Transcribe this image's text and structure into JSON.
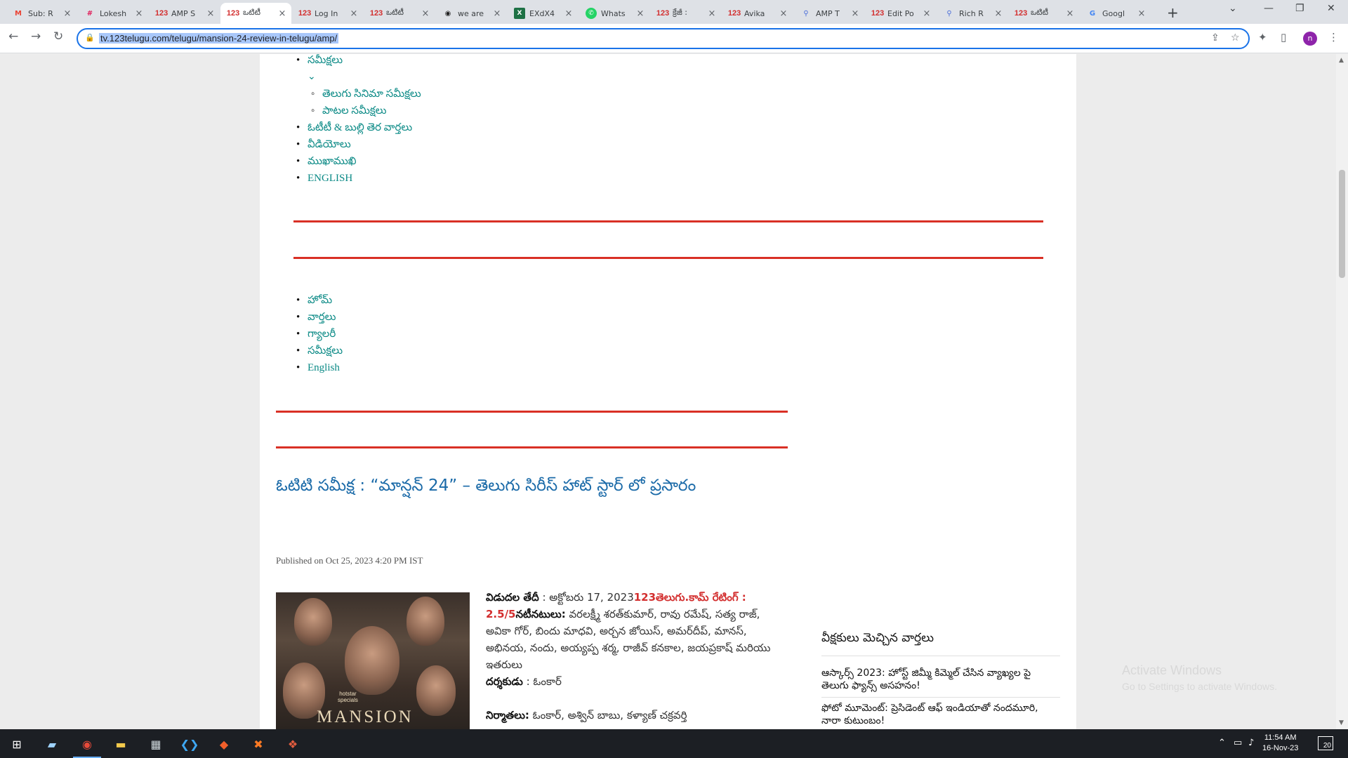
{
  "browser": {
    "tabs": [
      {
        "icon": "gmail-icon",
        "glyph": "M",
        "title": "Sub: R"
      },
      {
        "icon": "slack-icon",
        "glyph": "#",
        "title": "Lokesh"
      },
      {
        "icon": "site-123-icon",
        "glyph": "123",
        "title": "AMP S"
      },
      {
        "icon": "site-123-icon",
        "glyph": "123",
        "title": "ఒటిటీ"
      },
      {
        "icon": "site-123-icon",
        "glyph": "123",
        "title": "Log In"
      },
      {
        "icon": "site-123-icon",
        "glyph": "123",
        "title": "ఒటిటీ"
      },
      {
        "icon": "eye-icon",
        "glyph": "◉",
        "title": "we are"
      },
      {
        "icon": "excel-icon",
        "glyph": "X",
        "title": "EXdX4"
      },
      {
        "icon": "whatsapp-icon",
        "glyph": "✆",
        "title": "Whats"
      },
      {
        "icon": "site-123-icon",
        "glyph": "123",
        "title": "క్రేజీ :"
      },
      {
        "icon": "site-123-icon",
        "glyph": "123",
        "title": "Avika"
      },
      {
        "icon": "amp-icon",
        "glyph": "⚲",
        "title": "AMP T"
      },
      {
        "icon": "site-123-icon",
        "glyph": "123",
        "title": "Edit Po"
      },
      {
        "icon": "amp-icon",
        "glyph": "⚲",
        "title": "Rich R"
      },
      {
        "icon": "site-123-icon",
        "glyph": "123",
        "title": "ఒటిటీ"
      },
      {
        "icon": "google-docs-icon",
        "glyph": "G",
        "title": "Googl"
      }
    ],
    "url": "tv.123telugu.com/telugu/mansion-24-review-in-telugu/amp/",
    "profile_initial": "n"
  },
  "menu_top": {
    "items": [
      "సమీక్షలు",
      "తెలుగు సినిమా సమీక్షలు",
      "పాటల సమీక్షలు",
      "ఓటీటీ & బుల్లి తెర వార్తలు",
      "వీడియోలు",
      "ముఖాముఖి",
      "ENGLISH"
    ],
    "chevron": "⌄"
  },
  "menu_second": {
    "items": [
      "హోమ్",
      "వార్తలు",
      "గ్యాలరీ",
      "సమీక్షలు",
      "English"
    ]
  },
  "article": {
    "headline": "ఓటిటి సమీక్ష : “మాన్షన్ 24” – తెలుగు సిరీస్ హాట్ స్టార్ లో ప్రసారం",
    "published": "Published on Oct 25, 2023 4:20 PM IST",
    "poster": {
      "brand_line1": "hotstar",
      "brand_line2": "specials",
      "title": "MANSION"
    },
    "release_label": "విడుదల తేదీ",
    "release_value": " : అక్టోబరు 17, 2023",
    "rating_label": "123తెలుగు.కామ్ రేటింగ్ : 2.5/5",
    "cast_label": "నటీనటులు:",
    "cast_value": " వరలక్ష్మీ శరత్‌కుమార్, రావు రమేష్, సత్య రాజ్, అవికా గోర్, బిందు మాధవి, అర్చన జోయిస్, అమర్‌దీప్, మానస్, అభినయ, నందు, అయ్యప్ప శర్మ, రాజీవ్ కనకాల, జయప్రకాష్ మరియు ఇతరులు",
    "director_label": "దర్శకుడు",
    "director_value": " : ఓంకార్",
    "producers_label": "నిర్మాతలు:",
    "producers_value": " ఓంకార్, అశ్విన్ బాబు, కళ్యాణ్ చక్రవర్తి"
  },
  "sidebar": {
    "title": "వీక్షకులు మెచ్చిన వార్తలు",
    "items": [
      "ఆస్కార్స్ 2023: హోస్ట్ జిమ్మీ కిమ్మెల్ చేసిన వ్యాఖ్యల పై తెలుగు ఫ్యాన్స్ అసహనం!",
      "ఫోటో మూమెంట్: ప్రెసిడెంట్ ఆఫ్ ఇండియాతో నందమూరి, నారా కుటుంబం!"
    ]
  },
  "watermark": {
    "line1": "Activate Windows",
    "line2": "Go to Settings to activate Windows."
  },
  "taskbar": {
    "time": "11:54 AM",
    "date": "16-Nov-23",
    "notifications": "20"
  }
}
